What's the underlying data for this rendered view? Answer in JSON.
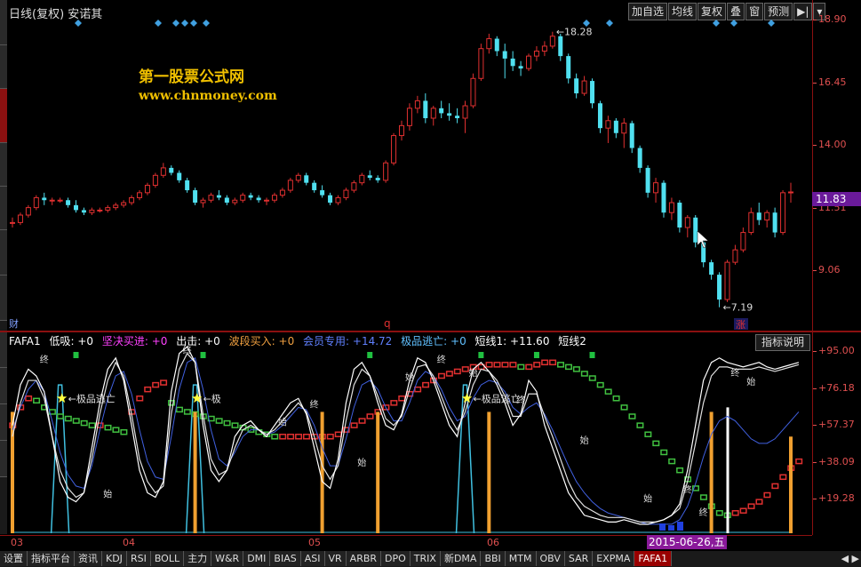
{
  "header": {
    "title": "日线(复权)  安诺其",
    "toolbar": [
      "加自选",
      "均线",
      "复权",
      "叠",
      "窗",
      "预测",
      "▶|",
      "▾"
    ]
  },
  "watermark": {
    "title": "第一股票公式网",
    "url": "www.chnmoney.com"
  },
  "price_axis": {
    "labels": [
      "18.90",
      "16.45",
      "14.00",
      "11.51",
      "9.06"
    ],
    "current": "11.83"
  },
  "price_annotations": {
    "high": "18.28",
    "low": "7.19",
    "low_prefix": "←"
  },
  "markers": {
    "cai": "财",
    "q": "q",
    "zhang": "涨"
  },
  "indicator": {
    "name": "FAFA1",
    "legend": [
      {
        "label": "低吸: +0",
        "color": "#ffffff"
      },
      {
        "label": "坚决买进: +0",
        "color": "#ff40ff"
      },
      {
        "label": "出击: +0",
        "color": "#ffffff"
      },
      {
        "label": "波段买入: +0",
        "color": "#f0a040"
      },
      {
        "label": "会员专用: +14.72",
        "color": "#6080ff"
      },
      {
        "label": "极品逃亡: +0",
        "color": "#60c0ff"
      },
      {
        "label": "短线1: +11.60",
        "color": "#ffffff"
      },
      {
        "label": "短线2",
        "color": "#ffffff"
      }
    ],
    "explain_button": "指标说明",
    "axis_labels": [
      "+95.00",
      "+76.18",
      "+57.37",
      "+38.09",
      "+19.28"
    ],
    "signal_labels": {
      "escape": "极品逃亡",
      "escape_short": "极",
      "zhong": "终",
      "shi": "始"
    }
  },
  "date_axis": {
    "labels": [
      "03",
      "04",
      "05",
      "06"
    ],
    "cursor": "2015-06-26,五"
  },
  "bottom_tabs": [
    "设置",
    "指标平台",
    "资讯",
    "KDJ",
    "RSI",
    "BOLL",
    "主力",
    "W&R",
    "DMI",
    "BIAS",
    "ASI",
    "VR",
    "ARBR",
    "DPO",
    "TRIX",
    "新DMA",
    "BBI",
    "MTM",
    "OBV",
    "SAR",
    "EXPMA",
    "FAFA1"
  ],
  "active_tab": "FAFA1",
  "tab_nav": "◀ ▶",
  "colors": {
    "up": "#e03030",
    "down": "#50e0f0",
    "axis": "#e05050",
    "frame": "#8b1010",
    "diamond": "#40a0e0"
  },
  "chart_data": {
    "type": "candlestick",
    "yrange": [
      6.5,
      19.2
    ],
    "candles": [
      [
        10.6,
        10.8,
        10.4,
        10.6
      ],
      [
        10.6,
        11.0,
        10.5,
        10.9
      ],
      [
        10.9,
        11.3,
        10.8,
        11.2
      ],
      [
        11.2,
        11.7,
        11.1,
        11.6
      ],
      [
        11.6,
        11.8,
        11.3,
        11.5
      ],
      [
        11.5,
        11.6,
        11.3,
        11.5
      ],
      [
        11.5,
        11.6,
        11.4,
        11.5
      ],
      [
        11.5,
        11.6,
        11.2,
        11.3
      ],
      [
        11.3,
        11.5,
        11.0,
        11.1
      ],
      [
        11.1,
        11.2,
        10.9,
        11.0
      ],
      [
        11.0,
        11.2,
        10.9,
        11.1
      ],
      [
        11.1,
        11.2,
        11.0,
        11.1
      ],
      [
        11.1,
        11.3,
        11.0,
        11.2
      ],
      [
        11.2,
        11.4,
        11.1,
        11.3
      ],
      [
        11.3,
        11.5,
        11.2,
        11.4
      ],
      [
        11.4,
        11.7,
        11.3,
        11.6
      ],
      [
        11.6,
        11.9,
        11.5,
        11.8
      ],
      [
        11.8,
        12.2,
        11.7,
        12.1
      ],
      [
        12.1,
        12.6,
        12.0,
        12.5
      ],
      [
        12.5,
        13.0,
        12.4,
        12.8
      ],
      [
        12.8,
        12.9,
        12.5,
        12.6
      ],
      [
        12.6,
        12.7,
        12.2,
        12.3
      ],
      [
        12.3,
        12.4,
        11.8,
        11.9
      ],
      [
        11.9,
        12.0,
        11.3,
        11.4
      ],
      [
        11.4,
        11.6,
        11.2,
        11.5
      ],
      [
        11.5,
        11.8,
        11.4,
        11.7
      ],
      [
        11.7,
        11.9,
        11.5,
        11.6
      ],
      [
        11.6,
        11.7,
        11.3,
        11.4
      ],
      [
        11.4,
        11.6,
        11.3,
        11.5
      ],
      [
        11.5,
        11.8,
        11.4,
        11.7
      ],
      [
        11.7,
        11.8,
        11.5,
        11.6
      ],
      [
        11.6,
        11.7,
        11.4,
        11.5
      ],
      [
        11.5,
        11.6,
        11.3,
        11.5
      ],
      [
        11.5,
        11.8,
        11.4,
        11.7
      ],
      [
        11.7,
        12.0,
        11.6,
        11.9
      ],
      [
        11.9,
        12.4,
        11.8,
        12.3
      ],
      [
        12.3,
        12.6,
        12.2,
        12.5
      ],
      [
        12.5,
        12.6,
        12.1,
        12.2
      ],
      [
        12.2,
        12.3,
        11.8,
        11.9
      ],
      [
        11.9,
        12.1,
        11.6,
        11.7
      ],
      [
        11.7,
        11.8,
        11.3,
        11.4
      ],
      [
        11.4,
        11.7,
        11.3,
        11.6
      ],
      [
        11.6,
        12.0,
        11.5,
        11.9
      ],
      [
        11.9,
        12.3,
        11.8,
        12.2
      ],
      [
        12.2,
        12.6,
        12.1,
        12.5
      ],
      [
        12.5,
        12.7,
        12.3,
        12.4
      ],
      [
        12.4,
        12.5,
        12.2,
        12.3
      ],
      [
        12.3,
        13.1,
        12.2,
        13.0
      ],
      [
        13.0,
        14.2,
        12.9,
        14.1
      ],
      [
        14.1,
        14.7,
        13.9,
        14.5
      ],
      [
        14.5,
        15.4,
        14.3,
        15.2
      ],
      [
        15.2,
        15.7,
        15.0,
        15.5
      ],
      [
        15.5,
        15.8,
        14.6,
        14.8
      ],
      [
        14.8,
        15.3,
        14.5,
        15.2
      ],
      [
        15.2,
        15.5,
        14.8,
        15.0
      ],
      [
        15.0,
        15.4,
        14.7,
        14.9
      ],
      [
        14.9,
        15.2,
        14.6,
        14.8
      ],
      [
        14.8,
        15.5,
        14.2,
        15.3
      ],
      [
        15.3,
        16.6,
        15.2,
        16.4
      ],
      [
        16.4,
        17.8,
        16.3,
        17.6
      ],
      [
        17.6,
        18.2,
        17.4,
        18.0
      ],
      [
        18.0,
        18.1,
        17.3,
        17.5
      ],
      [
        17.5,
        17.8,
        16.4,
        17.2
      ],
      [
        17.2,
        17.5,
        16.7,
        16.9
      ],
      [
        16.9,
        17.1,
        16.5,
        16.8
      ],
      [
        16.8,
        17.4,
        16.7,
        17.3
      ],
      [
        17.3,
        17.7,
        17.1,
        17.5
      ],
      [
        17.5,
        17.9,
        17.3,
        17.7
      ],
      [
        17.7,
        18.28,
        17.6,
        18.1
      ],
      [
        18.1,
        18.2,
        17.1,
        17.3
      ],
      [
        17.3,
        17.4,
        16.2,
        16.4
      ],
      [
        16.4,
        16.6,
        15.6,
        15.8
      ],
      [
        15.8,
        16.5,
        15.7,
        16.3
      ],
      [
        16.3,
        16.4,
        15.2,
        15.4
      ],
      [
        15.4,
        15.5,
        14.2,
        14.4
      ],
      [
        14.4,
        14.9,
        13.8,
        14.7
      ],
      [
        14.7,
        14.8,
        14.0,
        14.2
      ],
      [
        14.2,
        14.8,
        13.6,
        14.6
      ],
      [
        14.6,
        14.7,
        13.4,
        13.6
      ],
      [
        13.6,
        13.7,
        12.6,
        12.8
      ],
      [
        12.8,
        12.9,
        11.6,
        11.8
      ],
      [
        11.8,
        12.4,
        11.4,
        12.2
      ],
      [
        12.2,
        12.3,
        10.8,
        11.0
      ],
      [
        11.0,
        11.6,
        10.7,
        11.4
      ],
      [
        11.4,
        11.5,
        10.2,
        10.4
      ],
      [
        10.4,
        10.9,
        10.0,
        10.8
      ],
      [
        10.8,
        10.9,
        9.6,
        9.8
      ],
      [
        9.8,
        9.9,
        8.8,
        9.0
      ],
      [
        9.0,
        9.1,
        8.3,
        8.5
      ],
      [
        8.5,
        8.6,
        7.19,
        7.5
      ],
      [
        7.5,
        9.1,
        7.4,
        9.0
      ],
      [
        9.0,
        9.7,
        8.9,
        9.5
      ],
      [
        9.5,
        10.4,
        9.4,
        10.2
      ],
      [
        10.2,
        11.2,
        10.1,
        11.0
      ],
      [
        11.0,
        11.4,
        10.5,
        10.7
      ],
      [
        10.7,
        11.1,
        10.4,
        11.0
      ],
      [
        11.0,
        11.2,
        10.0,
        10.2
      ],
      [
        10.2,
        11.9,
        10.1,
        11.8
      ],
      [
        11.8,
        12.2,
        11.4,
        11.83
      ]
    ],
    "ind_range": [
      12,
      99
    ],
    "long_line": [
      60,
      68,
      72,
      71,
      68,
      66,
      64,
      63,
      62,
      61,
      60,
      60,
      59,
      58,
      57,
      66,
      72,
      76,
      78,
      79,
      70,
      67,
      66,
      65,
      64,
      63,
      62,
      61,
      60,
      59,
      58,
      57,
      56,
      55,
      55,
      55,
      55,
      55,
      55,
      55,
      55,
      56,
      58,
      60,
      62,
      64,
      66,
      68,
      70,
      72,
      74,
      76,
      78,
      80,
      82,
      83,
      84,
      85,
      86,
      86,
      87,
      87,
      87,
      87,
      86,
      86,
      87,
      88,
      88,
      87,
      86,
      85,
      83,
      81,
      78,
      75,
      72,
      68,
      64,
      60,
      56,
      52,
      48,
      44,
      40,
      36,
      32,
      28,
      24,
      21,
      20,
      21,
      22,
      24,
      26,
      29,
      33,
      37,
      41,
      44
    ],
    "fast_line": [
      60,
      78,
      85,
      82,
      75,
      55,
      35,
      28,
      26,
      30,
      50,
      70,
      85,
      90,
      80,
      60,
      40,
      30,
      28,
      35,
      75,
      92,
      95,
      88,
      60,
      40,
      35,
      40,
      55,
      60,
      62,
      58,
      55,
      60,
      65,
      70,
      72,
      65,
      50,
      35,
      32,
      45,
      70,
      85,
      88,
      82,
      70,
      60,
      58,
      65,
      80,
      90,
      88,
      80,
      70,
      60,
      55,
      70,
      85,
      88,
      84,
      78,
      70,
      60,
      65,
      80,
      75,
      60,
      50,
      40,
      30,
      25,
      20,
      19,
      18,
      17,
      17,
      18,
      17,
      16,
      16,
      17,
      18,
      20,
      25,
      40,
      60,
      80,
      88,
      90,
      88,
      87,
      86,
      87,
      88,
      86,
      85,
      86,
      87,
      88
    ],
    "slow_line": [
      55,
      70,
      80,
      80,
      72,
      55,
      40,
      32,
      28,
      30,
      45,
      65,
      80,
      88,
      82,
      65,
      45,
      35,
      30,
      33,
      65,
      85,
      92,
      88,
      65,
      45,
      38,
      40,
      50,
      58,
      60,
      58,
      56,
      58,
      62,
      66,
      70,
      66,
      55,
      42,
      36,
      42,
      62,
      78,
      85,
      82,
      73,
      63,
      60,
      64,
      76,
      86,
      87,
      82,
      73,
      64,
      58,
      66,
      78,
      85,
      84,
      80,
      73,
      64,
      64,
      74,
      74,
      64,
      55,
      45,
      35,
      28,
      24,
      22,
      20,
      19,
      19,
      19,
      18,
      17,
      17,
      17,
      18,
      20,
      23,
      35,
      52,
      70,
      82,
      86,
      86,
      85,
      85,
      85,
      86,
      85,
      84,
      85,
      86,
      87
    ],
    "member_line": [
      58,
      68,
      76,
      80,
      75,
      62,
      48,
      38,
      33,
      32,
      42,
      58,
      72,
      82,
      84,
      74,
      58,
      44,
      37,
      36,
      55,
      76,
      88,
      90,
      76,
      58,
      45,
      42,
      48,
      55,
      58,
      58,
      56,
      57,
      60,
      64,
      68,
      67,
      60,
      50,
      42,
      42,
      54,
      68,
      78,
      80,
      76,
      68,
      62,
      62,
      70,
      80,
      84,
      82,
      76,
      68,
      62,
      64,
      72,
      78,
      80,
      79,
      75,
      68,
      65,
      68,
      70,
      65,
      58,
      50,
      42,
      35,
      30,
      26,
      23,
      21,
      20,
      19,
      18,
      17,
      16,
      16,
      16,
      16,
      18,
      24,
      34,
      46,
      56,
      62,
      64,
      62,
      58,
      54,
      52,
      52,
      54,
      58,
      62,
      66
    ],
    "orange_bars": [
      0,
      23,
      39,
      46,
      60,
      88,
      98
    ],
    "cyan_peaks": [
      6,
      23,
      57
    ],
    "green_top_marks": [
      8,
      24,
      45,
      59,
      66,
      73
    ]
  }
}
